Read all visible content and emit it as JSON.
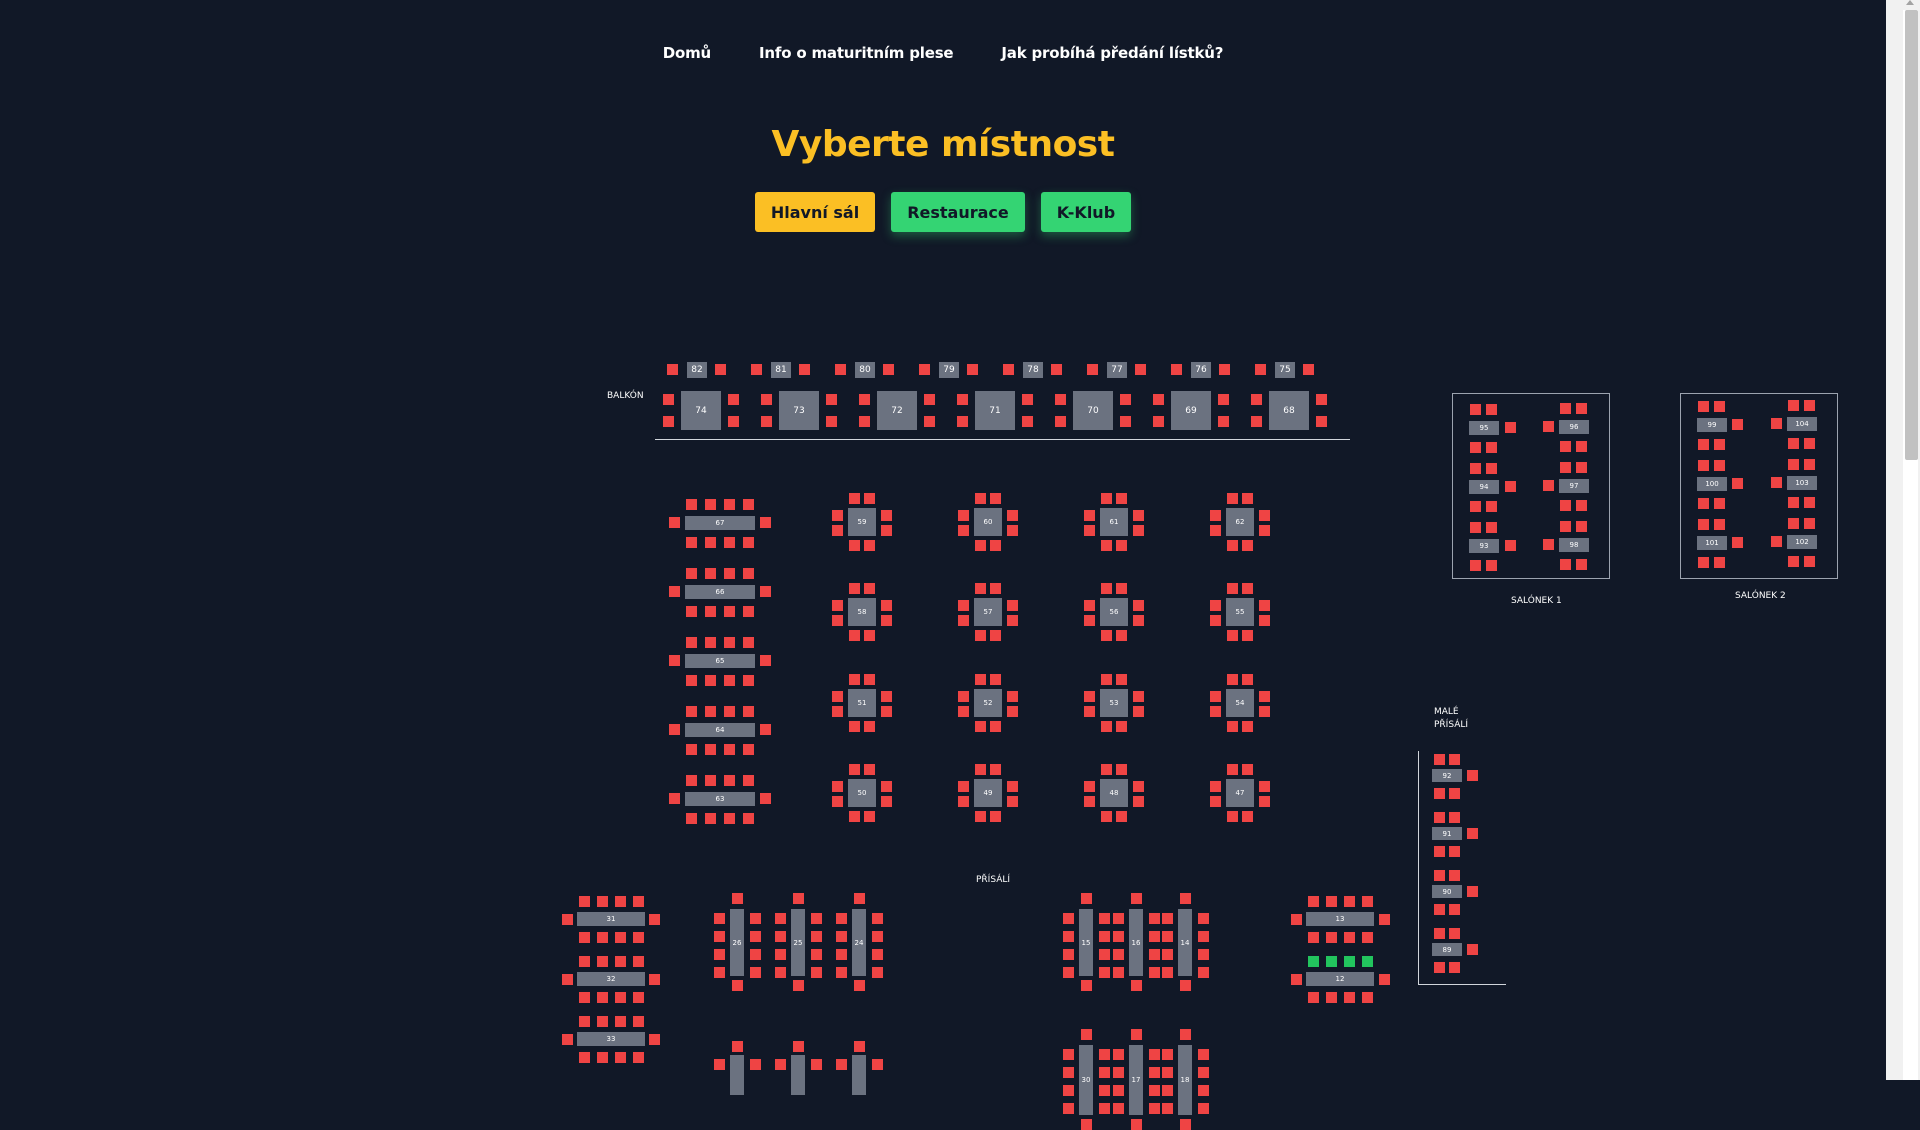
{
  "nav": {
    "items": [
      {
        "label": "Domů"
      },
      {
        "label": "Info o maturitním plese"
      },
      {
        "label": "Jak probíhá předání lístků?"
      }
    ]
  },
  "title": "Vyberte místnost",
  "rooms": [
    {
      "label": "Hlavní sál",
      "state": "active"
    },
    {
      "label": "Restaurace",
      "state": "available"
    },
    {
      "label": "K-Klub",
      "state": "available"
    }
  ],
  "hall": {
    "areas": {
      "balcony": "BALKÓN",
      "salonek1": "SALÓNEK 1",
      "salonek2": "SALÓNEK 2",
      "male_prisali": "MALÉ\nPŘÍSÁLÍ",
      "prisali": "PŘÍSÁLÍ"
    },
    "colors": {
      "occupied": "#ef4444",
      "free": "#22c55e",
      "table": "#6b7280",
      "accent": "#fbbf24"
    },
    "balcony_top_tables": [
      "82",
      "81",
      "80",
      "79",
      "78",
      "77",
      "76",
      "75"
    ],
    "balcony_tables": [
      "74",
      "73",
      "72",
      "71",
      "70",
      "69",
      "68"
    ],
    "long_tables_left": [
      "67",
      "66",
      "65",
      "64",
      "63"
    ],
    "grid_tables": [
      [
        "59",
        "60",
        "61",
        "62"
      ],
      [
        "58",
        "57",
        "56",
        "55"
      ],
      [
        "51",
        "52",
        "53",
        "54"
      ],
      [
        "50",
        "49",
        "48",
        "47"
      ]
    ],
    "salonek1_left": [
      "95",
      "94",
      "93"
    ],
    "salonek1_right": [
      "96",
      "97",
      "98"
    ],
    "salonek2_left": [
      "99",
      "100",
      "101"
    ],
    "salonek2_right": [
      "104",
      "103",
      "102"
    ],
    "male_prisali_tables": [
      "92",
      "91",
      "90",
      "89"
    ],
    "prisali_left_h": [
      "31",
      "32",
      "33"
    ],
    "prisali_vert_a": [
      "26",
      "25",
      "24"
    ],
    "prisali_vert_b": [
      "15",
      "16",
      "14"
    ],
    "prisali_right_h": [
      "13",
      "12"
    ],
    "bottom_vert": [
      "30",
      "17",
      "18"
    ]
  }
}
